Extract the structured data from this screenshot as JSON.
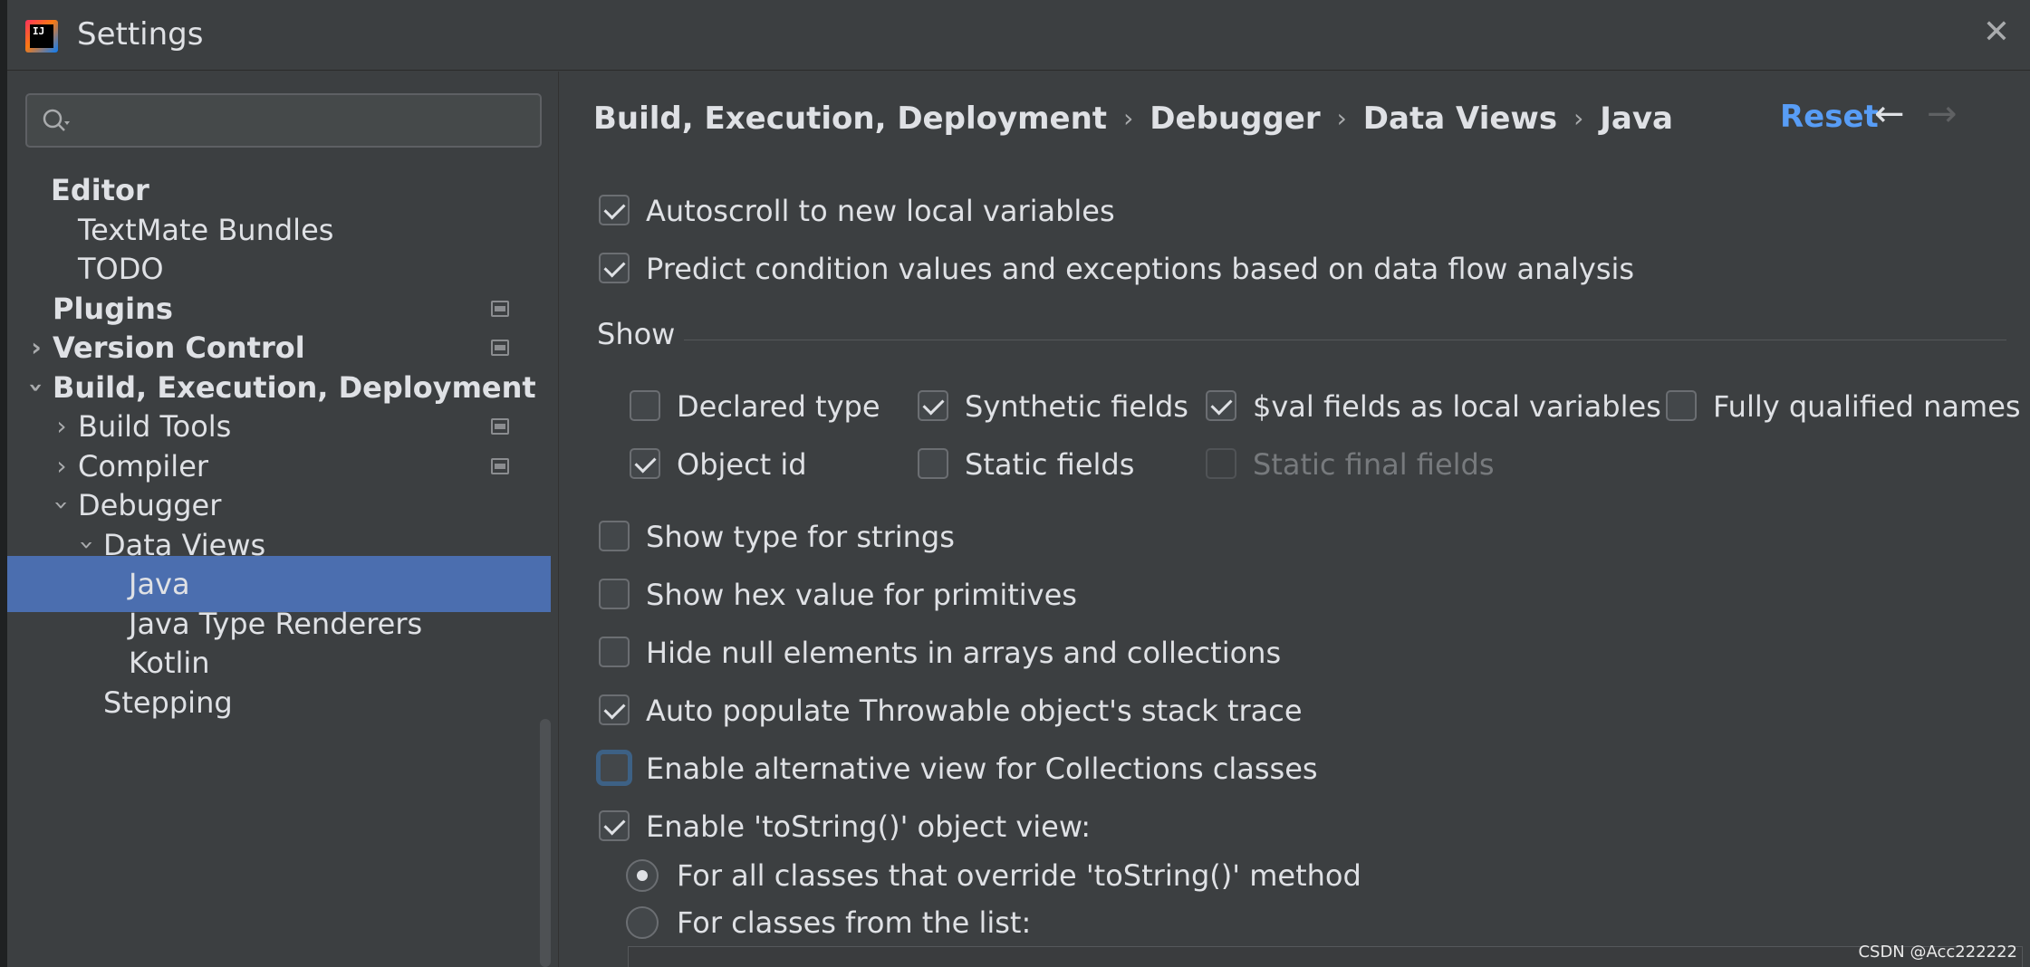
{
  "window": {
    "title": "Settings",
    "close_icon": "close-icon",
    "logo": "IJ"
  },
  "search": {
    "placeholder": "",
    "icon": "search-icon"
  },
  "sidebar": {
    "items": [
      {
        "label": "Editor",
        "bold": true
      },
      {
        "label": "TextMate Bundles"
      },
      {
        "label": "TODO"
      },
      {
        "label": "Plugins",
        "bold": true
      },
      {
        "label": "Version Control",
        "bold": true
      },
      {
        "label": "Build, Execution, Deployment",
        "bold": true
      },
      {
        "label": "Build Tools"
      },
      {
        "label": "Compiler"
      },
      {
        "label": "Debugger"
      },
      {
        "label": "Data Views"
      },
      {
        "label": "Java",
        "selected": true
      },
      {
        "label": "Java Type Renderers"
      },
      {
        "label": "Kotlin"
      },
      {
        "label": "Stepping"
      }
    ]
  },
  "header": {
    "breadcrumb": [
      "Build, Execution, Deployment",
      "Debugger",
      "Data Views",
      "Java"
    ],
    "reset_label": "Reset",
    "back_icon": "←",
    "forward_icon": "→"
  },
  "options": {
    "autoscroll": {
      "label": "Autoscroll to new local variables",
      "checked": true
    },
    "predict": {
      "label": "Predict condition values and exceptions based on data flow analysis",
      "checked": true
    },
    "show_group": "Show",
    "show": {
      "declared_type": {
        "label": "Declared type",
        "checked": false
      },
      "synthetic_fields": {
        "label": "Synthetic fields",
        "checked": true
      },
      "val_fields": {
        "label": "$val fields as local variables",
        "checked": true
      },
      "fully_qualified": {
        "label": "Fully qualified names",
        "checked": false
      },
      "object_id": {
        "label": "Object id",
        "checked": true
      },
      "static_fields": {
        "label": "Static fields",
        "checked": false
      },
      "static_final_fields": {
        "label": "Static final fields",
        "checked": false,
        "disabled": true
      }
    },
    "show_type_strings": {
      "label": "Show type for strings",
      "checked": false
    },
    "show_hex": {
      "label": "Show hex value for primitives",
      "checked": false
    },
    "hide_null": {
      "label": "Hide null elements in arrays and collections",
      "checked": false
    },
    "auto_populate": {
      "label": "Auto populate Throwable object's stack trace",
      "checked": true
    },
    "alt_view": {
      "label": "Enable alternative view for Collections classes",
      "checked": false
    },
    "tostring_view": {
      "label": "Enable 'toString()' object view:",
      "checked": true
    },
    "radio_all": {
      "label": "For all classes that override 'toString()' method",
      "selected": true
    },
    "radio_list": {
      "label": "For classes from the list:",
      "selected": false
    }
  },
  "watermark": "CSDN @Acc222222"
}
